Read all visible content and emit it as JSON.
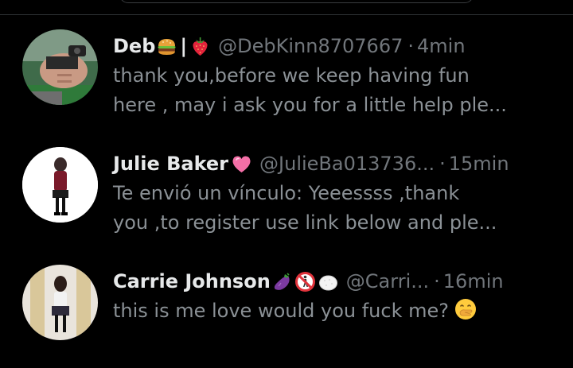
{
  "theme": {
    "background": "#000000",
    "name_color": "#e7e9ea",
    "muted_color": "#71767b",
    "preview_color": "#8b9196",
    "divider_color": "#2f3336"
  },
  "conversations": [
    {
      "name": "Deb",
      "name_emojis": [
        "hamburger-emoji",
        "strawberry-emoji"
      ],
      "name_separator": "|",
      "handle": "@DebKinn8707667",
      "separator": "·",
      "time": "4min",
      "preview_lines": [
        "thank you,before we keep having fun",
        "here , may i ask you for a little help ple..."
      ]
    },
    {
      "name": "Julie Baker",
      "name_emojis": [
        "pink-heart-emoji"
      ],
      "handle": "@JulieBa013736...",
      "separator": "·",
      "time": "15min",
      "preview_lines": [
        "Te envió un vínculo: Yeeessss ,thank",
        "you ,to register use link below and ple..."
      ]
    },
    {
      "name": "Carrie Johnson",
      "name_emojis": [
        "eggplant-emoji",
        "no-pedestrians-emoji",
        "rice-ball-emoji"
      ],
      "handle": "@Carri...",
      "separator": "·",
      "time": "16min",
      "preview_lines": [
        "this is me love would you fuck me?"
      ],
      "preview_emoji": "hand-over-mouth-emoji"
    }
  ]
}
